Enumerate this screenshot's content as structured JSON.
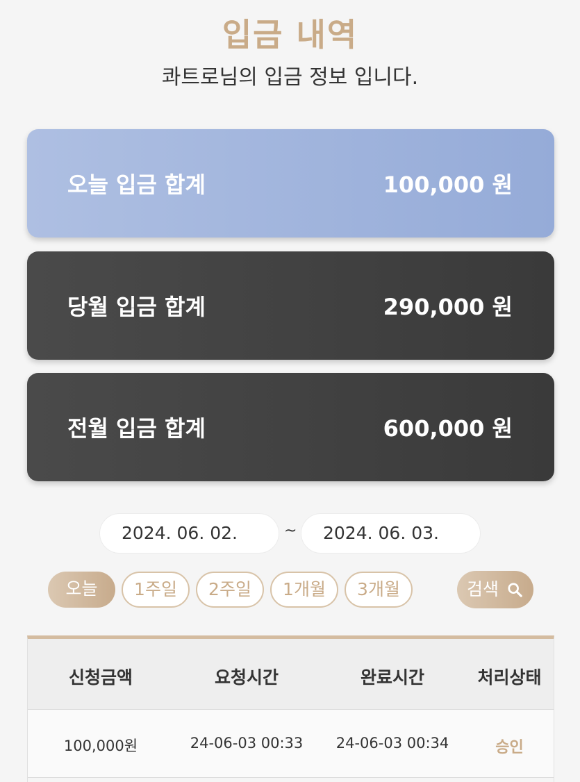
{
  "header": {
    "title": "입금 내역",
    "subtitle": "콰트로님의 입금 정보 입니다."
  },
  "summary": {
    "today": {
      "label": "오늘 입금 합계",
      "amount": "100,000 원"
    },
    "month": {
      "label": "당월 입금 합계",
      "amount": "290,000 원"
    },
    "prev_month": {
      "label": "전월 입금 합계",
      "amount": "600,000 원"
    }
  },
  "filter": {
    "start_date": "2024. 06. 02.",
    "separator": "~",
    "end_date": "2024. 06. 03.",
    "periods": [
      "오늘",
      "1주일",
      "2주일",
      "1개월",
      "3개월"
    ],
    "active_period": "오늘",
    "search_label": "검색"
  },
  "table": {
    "headers": [
      "신청금액",
      "요청시간",
      "완료시간",
      "처리상태"
    ],
    "rows": [
      [
        "100,000원",
        "24-06-03 00:33",
        "24-06-03 00:34",
        "승인"
      ]
    ]
  },
  "colors": {
    "accent": "#c9ab88",
    "today_card": "#a4b7de",
    "dark_card": "#424242"
  }
}
